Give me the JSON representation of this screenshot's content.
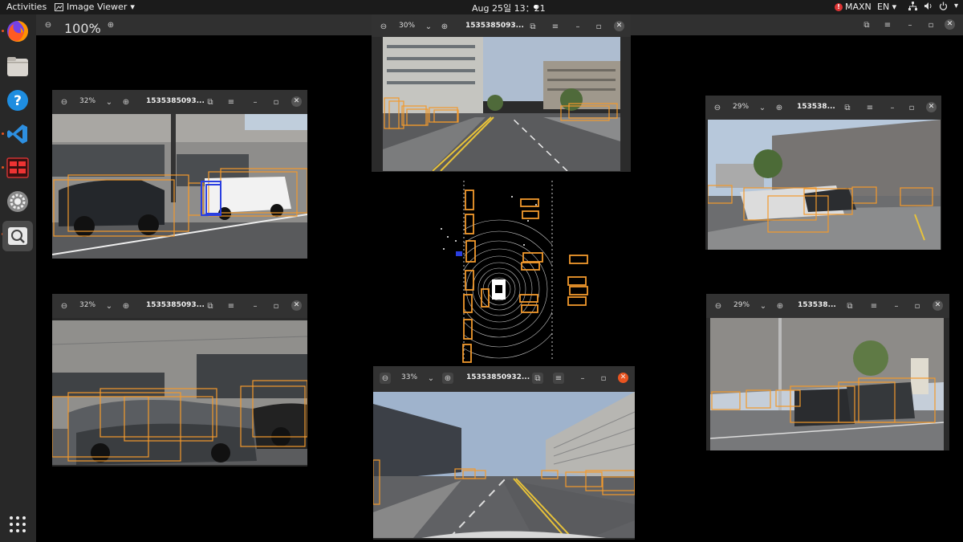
{
  "topbar": {
    "activities": "Activities",
    "app_name": "Image Viewer",
    "clock": "Aug 25일 13：21",
    "power_mode": "MAXN",
    "language": "EN"
  },
  "main_viewer": {
    "zoom": "100%"
  },
  "windows": {
    "front": {
      "zoom": "30%",
      "title": "1535385093..."
    },
    "front_left": {
      "zoom": "32%",
      "title": "1535385093..."
    },
    "front_right": {
      "zoom": "29%",
      "title": "153538..."
    },
    "back_left": {
      "zoom": "32%",
      "title": "1535385093..."
    },
    "back_right": {
      "zoom": "29%",
      "title": "153538..."
    },
    "back": {
      "zoom": "33%",
      "title": "15353850932..."
    }
  },
  "dock": {
    "apps": [
      "firefox-icon",
      "files-icon",
      "help-icon",
      "vscode-icon",
      "monitor-icon",
      "settings-icon",
      "image-viewer-icon",
      "app-grid-icon"
    ]
  },
  "colors": {
    "box_orange": "#f39a2c",
    "box_blue": "#2a3fe0",
    "accent": "#e95420"
  }
}
